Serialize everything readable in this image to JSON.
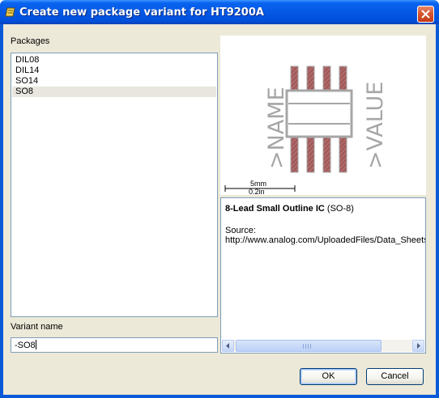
{
  "window": {
    "title": "Create new package variant for HT9200A"
  },
  "packages": {
    "label": "Packages",
    "items": [
      "DIL08",
      "DIL14",
      "SO14",
      "SO8"
    ],
    "selected": "SO8"
  },
  "preview": {
    "name_text": ">NAME",
    "value_text": ">VALUE",
    "scale_mm": "5mm",
    "scale_in": "0.2in",
    "colors": {
      "outline": "#a6a6a6",
      "pad": "#a15a5a",
      "text": "#a6a6a6"
    }
  },
  "description": {
    "title_bold": "8-Lead Small Outline IC",
    "title_normal": " (SO-8)",
    "source_label": "Source:",
    "source_url": "http://www.analog.com/UploadedFiles/Data_Sheets/"
  },
  "variant": {
    "label": "Variant name",
    "value": "-SO8"
  },
  "buttons": {
    "ok": "OK",
    "cancel": "Cancel"
  }
}
